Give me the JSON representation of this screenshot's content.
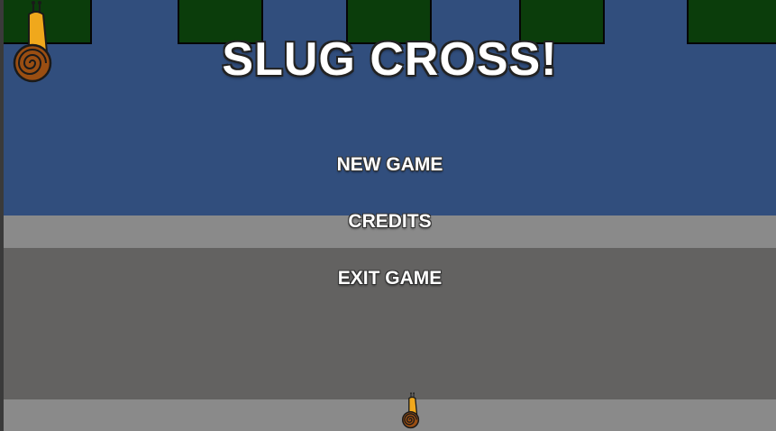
{
  "game": {
    "title": "SLUG CROSS!",
    "menu": {
      "new_game": "NEW GAME",
      "credits": "CREDITS",
      "exit_game": "EXIT GAME"
    }
  },
  "icons": {
    "logo_snail": "snail-icon",
    "player_snail": "snail-icon"
  },
  "colors": {
    "water": "#314e7d",
    "grass": "#0b3d0b",
    "sidewalk": "#8a8a8a",
    "road": "#636261",
    "text": "#ffffff"
  }
}
